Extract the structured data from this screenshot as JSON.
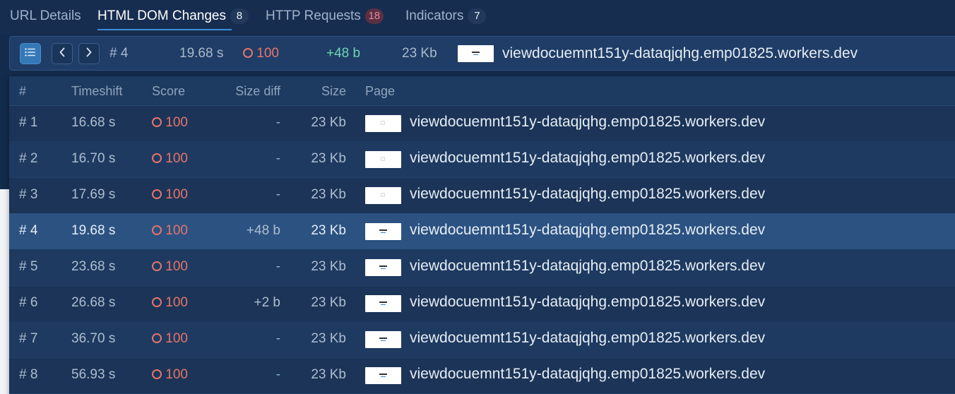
{
  "tabs": [
    {
      "label": "URL Details",
      "badge": ""
    },
    {
      "label": "HTML DOM Changes",
      "badge": "8"
    },
    {
      "label": "HTTP Requests",
      "badge": "18"
    },
    {
      "label": "Indicators",
      "badge": "7"
    }
  ],
  "toolbar": {
    "list_icon": "list-icon",
    "prev_icon": "chevron-left-icon",
    "next_icon": "chevron-right-icon",
    "index": "# 4",
    "timeshift": "19.68 s",
    "score": "100",
    "size_diff": "+48 b",
    "size": "23 Kb",
    "page": "viewdocuemnt151y-dataqjqhg.emp01825.workers.dev"
  },
  "table": {
    "headers": {
      "index": "#",
      "timeshift": "Timeshift",
      "score": "Score",
      "size_diff": "Size diff",
      "size": "Size",
      "page": "Page"
    },
    "rows": [
      {
        "index": "# 1",
        "timeshift": "16.68 s",
        "score": "100",
        "size_diff": "-",
        "size": "23 Kb",
        "page": "viewdocuemnt151y-dataqjqhg.emp01825.workers.dev"
      },
      {
        "index": "# 2",
        "timeshift": "16.70 s",
        "score": "100",
        "size_diff": "-",
        "size": "23 Kb",
        "page": "viewdocuemnt151y-dataqjqhg.emp01825.workers.dev"
      },
      {
        "index": "# 3",
        "timeshift": "17.69 s",
        "score": "100",
        "size_diff": "-",
        "size": "23 Kb",
        "page": "viewdocuemnt151y-dataqjqhg.emp01825.workers.dev"
      },
      {
        "index": "# 4",
        "timeshift": "19.68 s",
        "score": "100",
        "size_diff": "+48 b",
        "size": "23 Kb",
        "page": "viewdocuemnt151y-dataqjqhg.emp01825.workers.dev"
      },
      {
        "index": "# 5",
        "timeshift": "23.68 s",
        "score": "100",
        "size_diff": "-",
        "size": "23 Kb",
        "page": "viewdocuemnt151y-dataqjqhg.emp01825.workers.dev"
      },
      {
        "index": "# 6",
        "timeshift": "26.68 s",
        "score": "100",
        "size_diff": "+2 b",
        "size": "23 Kb",
        "page": "viewdocuemnt151y-dataqjqhg.emp01825.workers.dev"
      },
      {
        "index": "# 7",
        "timeshift": "36.70 s",
        "score": "100",
        "size_diff": "-",
        "size": "23 Kb",
        "page": "viewdocuemnt151y-dataqjqhg.emp01825.workers.dev"
      },
      {
        "index": "# 8",
        "timeshift": "56.93 s",
        "score": "100",
        "size_diff": "-",
        "size": "23 Kb",
        "page": "viewdocuemnt151y-dataqjqhg.emp01825.workers.dev"
      }
    ]
  },
  "colors": {
    "accent": "#3b8ed8",
    "score": "#e5746a",
    "positive_diff": "#6fd3b0",
    "background": "#132b4d"
  }
}
